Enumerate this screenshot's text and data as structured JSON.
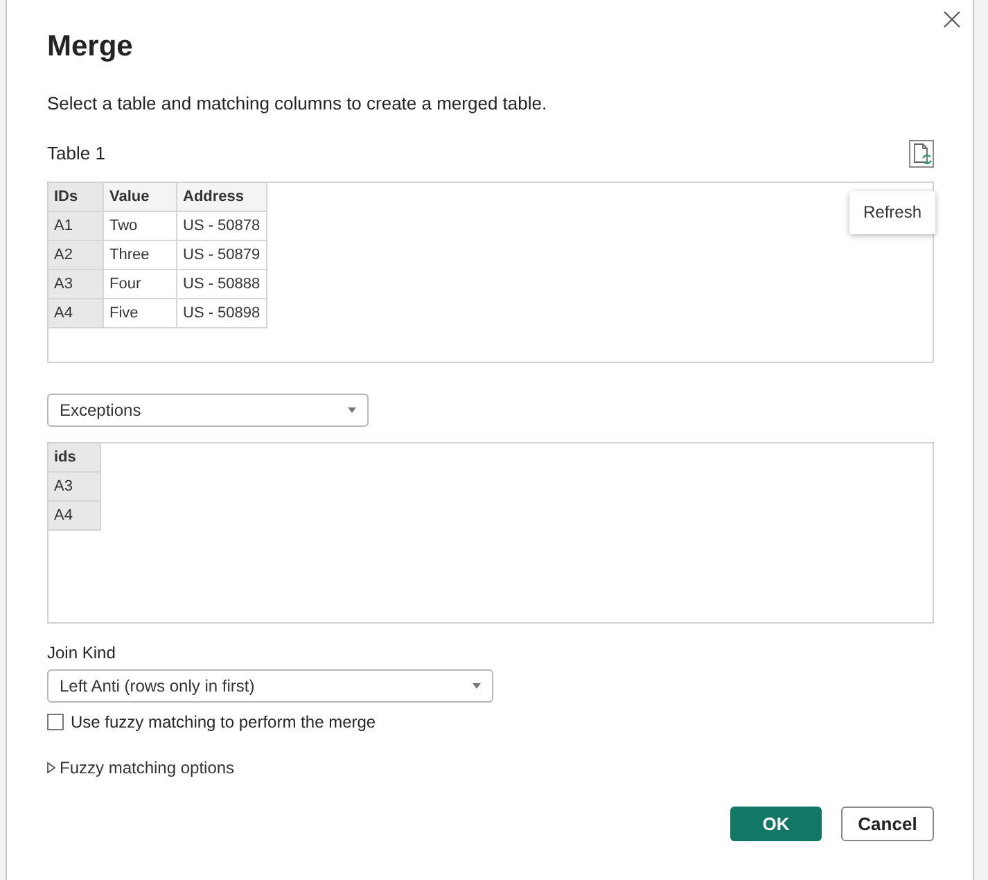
{
  "dialog": {
    "title": "Merge",
    "description": "Select a table and matching columns to create a merged table."
  },
  "first_table": {
    "label": "Table 1",
    "refresh_tooltip": "Refresh",
    "columns": [
      "IDs",
      "Value",
      "Address"
    ],
    "rows": [
      [
        "A1",
        "Two",
        "US - 50878"
      ],
      [
        "A2",
        "Three",
        "US - 50879"
      ],
      [
        "A3",
        "Four",
        "US - 50888"
      ],
      [
        "A4",
        "Five",
        "US - 50898"
      ]
    ]
  },
  "second_table": {
    "selector": {
      "value": "Exceptions"
    },
    "columns": [
      "ids"
    ],
    "rows": [
      [
        "A3"
      ],
      [
        "A4"
      ]
    ]
  },
  "join_kind": {
    "label": "Join Kind",
    "value": "Left Anti (rows only in first)"
  },
  "fuzzy_matching": {
    "label": "Use fuzzy matching to perform the merge",
    "checked": false
  },
  "fuzzy_options": {
    "label": "Fuzzy matching options",
    "expanded": false
  },
  "buttons": [
    {
      "label": "OK",
      "kind": "primary"
    },
    {
      "label": "Cancel",
      "kind": "secondary"
    }
  ]
}
